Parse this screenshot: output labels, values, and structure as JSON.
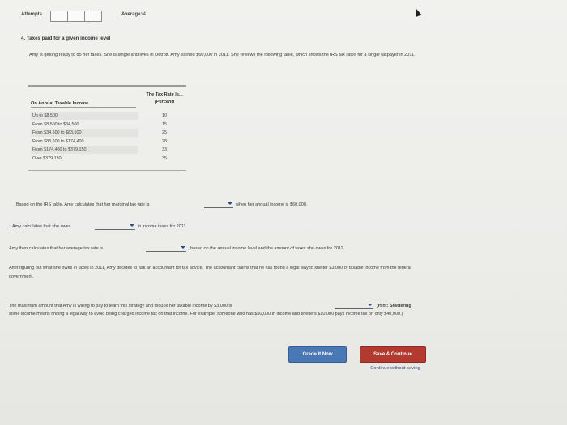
{
  "header": {
    "attempts_label": "Attempts",
    "attempt_boxes": 3,
    "average_label": "Average:",
    "average_value": "/4"
  },
  "question": {
    "title": "4. Taxes paid for a given income level",
    "intro": "Amy is getting ready to do her taxes. She is single and lives in Detroit. Amy earned $60,000 in 2011. She reviews the following table, which shows the IRS tax rates for a single taxpayer in 2011."
  },
  "tax_table": {
    "col1_header": "On Annual Taxable Income...",
    "col2_header": "The Tax Rate Is...",
    "col2_sub": "(Percent)",
    "rows": [
      {
        "income": "Up to $8,500",
        "rate": "10"
      },
      {
        "income": "From $8,500 to $34,500",
        "rate": "15"
      },
      {
        "income": "From $34,500 to $83,600",
        "rate": "25"
      },
      {
        "income": "From $83,600 to $174,400",
        "rate": "28"
      },
      {
        "income": "From $174,400 to $379,150",
        "rate": "33"
      },
      {
        "income": "Over $379,150",
        "rate": "35"
      }
    ]
  },
  "q1": {
    "before": "Based on the IRS table, Amy calculates that her marginal tax rate is",
    "after": "when her annual income is $60,000."
  },
  "q2": {
    "before": "Amy calculates that she owes",
    "after": "in income taxes for 2011."
  },
  "q3": {
    "before": "Amy then calculates that her average tax rate is",
    "after": ", based on the annual income level and the amount of taxes she owes for 2011."
  },
  "paragraph": "After figuring out what she owes in taxes in 2011, Amy decides to ask an accountant for tax advice. The accountant claims that he has found a legal way to shelter $3,000 of taxable income from the federal government.",
  "q4": {
    "before": "The maximum amount that Amy is willing to pay to learn this strategy and reduce her taxable income by $3,000 is",
    "hint": "(Hint: Sheltering",
    "rest": "some income means finding a legal way to avoid being charged income tax on that income. For example, someone who has $50,000 in income and shelters $10,000 pays income tax on only $40,000.)"
  },
  "buttons": {
    "grade": "Grade It Now",
    "save": "Save & Continue",
    "continue": "Continue without saving"
  },
  "colors": {
    "grade_button": "#4a78b4",
    "save_button": "#b23a2e",
    "dropdown_arrow": "#2a4b86"
  }
}
